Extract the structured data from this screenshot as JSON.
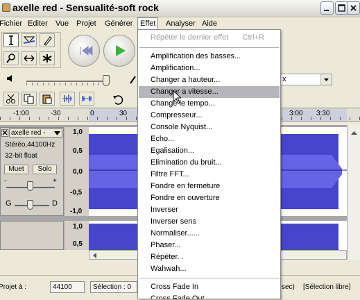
{
  "window": {
    "title": "axelle red - Sensualité-soft rock",
    "minimize_icon": "minimize-icon",
    "maximize_icon": "maximize-icon",
    "close_icon": "close-icon"
  },
  "menubar": {
    "items": [
      "Fichier",
      "Editer",
      "Vue",
      "Projet",
      "Générer",
      "Effet",
      "Analyser",
      "Aide"
    ]
  },
  "effet_menu": {
    "repeat": {
      "label": "Répéter le dernier effet",
      "shortcut": "Ctrl+R"
    },
    "items": [
      "Amplification des basses...",
      "Amplification...",
      "Changer a hauteur...",
      "Changer a vitesse...",
      "Change le tempo...",
      "Compresseur...",
      "Console Nyquist...",
      "Echo...",
      "Egalisation...",
      "Elimination du bruit...",
      "Filtre FFT...",
      "Fondre en fermeture",
      "Fondre en ouverture",
      "Inverser",
      "Inverser sens",
      "Normaliser......",
      "Phaser...",
      "Répéter. .",
      "Wahwah..."
    ],
    "items2": [
      "Cross Fade In",
      "Cross Fade Out"
    ],
    "highlighted": "Changer a vitesse..."
  },
  "ruler": {
    "labels": [
      "-1:00",
      "-30",
      "0",
      "30",
      "3:00",
      "3:30"
    ]
  },
  "track": {
    "name": "axelle red -",
    "format": "Stéréo,44100Hz",
    "bits": "32-bit float",
    "mute": "Muet",
    "solo": "Solo",
    "gain_minus": "-",
    "gain_plus": "+",
    "pan_left": "G",
    "pan_right": "D",
    "scale": [
      "1,0",
      "0,5",
      "0,0",
      "-0,5",
      "-1,0"
    ],
    "scale2": [
      "1,0",
      "0,5"
    ]
  },
  "device": {
    "value": "x"
  },
  "status": {
    "rate_label": "Projet à :",
    "rate_value": "44100",
    "selection_label": "Sélection : 0",
    "sec_text": "sec)",
    "mode": "[Sélection libre]"
  },
  "colors": {
    "wave": "#3232c8",
    "highlight": "#b6b5bb"
  }
}
